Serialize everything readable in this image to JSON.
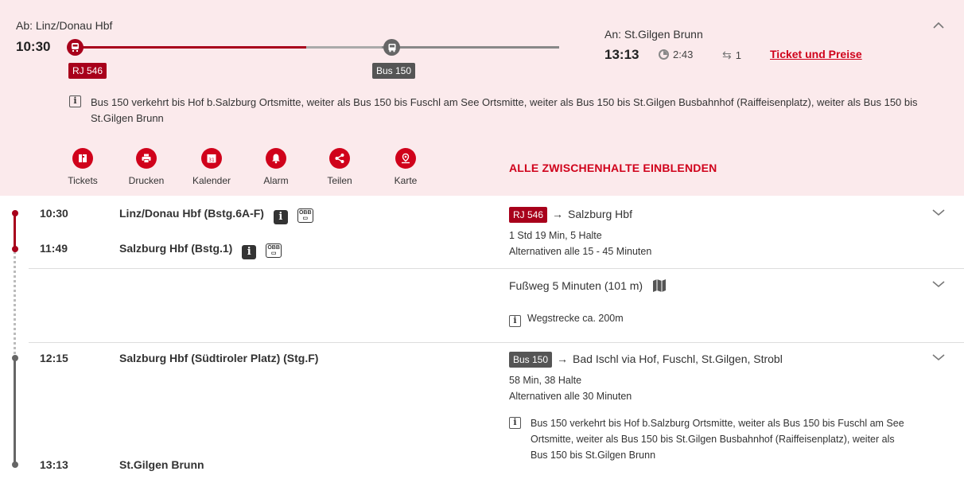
{
  "header": {
    "from_label": "Ab: Linz/Donau Hbf",
    "departure_time": "10:30",
    "to_label": "An: St.Gilgen Brunn",
    "arrival_time": "13:13",
    "duration": "2:43",
    "changes": "1",
    "ticket_link": "Ticket und Preise",
    "train_badge": "RJ 546",
    "bus_badge": "Bus 150",
    "info_text": "Bus 150 verkehrt bis Hof b.Salzburg Ortsmitte, weiter als Bus 150 bis Fuschl am See Ortsmitte, weiter als Bus 150 bis St.Gilgen Busbahnhof (Raiffeisenplatz), weiter als Bus 150 bis St.Gilgen Brunn"
  },
  "actions": [
    {
      "label": "Tickets",
      "icon": "tickets-icon"
    },
    {
      "label": "Drucken",
      "icon": "printer-icon"
    },
    {
      "label": "Kalender",
      "icon": "calendar-icon"
    },
    {
      "label": "Alarm",
      "icon": "bell-icon"
    },
    {
      "label": "Teilen",
      "icon": "share-icon"
    },
    {
      "label": "Karte",
      "icon": "map-icon"
    }
  ],
  "calendar_day": "31",
  "show_stops_label": "ALLE ZWISCHENHALTE EINBLENDEN",
  "segments": {
    "train": {
      "dep_time": "10:30",
      "dep_station": "Linz/Donau Hbf (Bstg.6A-F)",
      "arr_time": "11:49",
      "arr_station": "Salzburg Hbf (Bstg.1)",
      "badge": "RJ 546",
      "arrow": "→",
      "destination": "Salzburg Hbf",
      "details": "1 Std 19 Min, 5 Halte",
      "alternatives": "Alternativen alle 15 - 45 Minuten",
      "obb_label": "ÖBB"
    },
    "walk": {
      "title": "Fußweg 5 Minuten (101 m)",
      "info": "Wegstrecke ca. 200m"
    },
    "bus": {
      "dep_time": "12:15",
      "dep_station": "Salzburg Hbf (Südtiroler Platz) (Stg.F)",
      "arr_time": "13:13",
      "arr_station": "St.Gilgen Brunn",
      "badge": "Bus 150",
      "arrow": "→",
      "destination": "Bad Ischl via Hof, Fuschl, St.Gilgen, Strobl",
      "details": "58 Min, 38 Halte",
      "alternatives": "Alternativen alle 30 Minuten",
      "info": "Bus 150 verkehrt bis Hof b.Salzburg Ortsmitte, weiter als Bus 150 bis Fuschl am See Ortsmitte, weiter als Bus 150 bis St.Gilgen Busbahnhof (Raiffeisenplatz), weiter als Bus 150 bis St.Gilgen Brunn"
    }
  },
  "colors": {
    "accent": "#d0021b",
    "train": "#a8001b",
    "bus": "#555555",
    "header_bg": "#fbeaec"
  }
}
